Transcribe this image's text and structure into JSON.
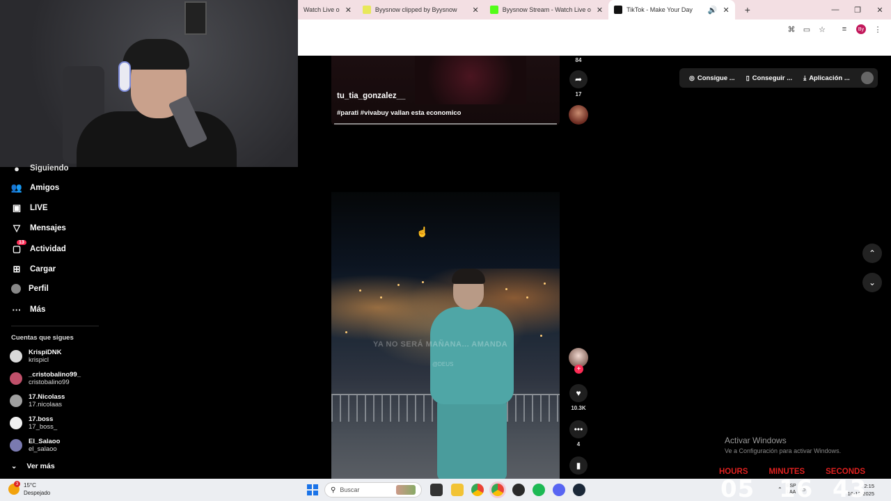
{
  "browser": {
    "tabs": [
      {
        "label": "Watch Live o",
        "color": "#9146ff"
      },
      {
        "label": "Byysnow clipped by Byysnow",
        "color": "#e8e85a"
      },
      {
        "label": "Byysnow Stream - Watch Live o",
        "color": "#53fc18"
      },
      {
        "label": "TikTok - Make Your Day",
        "color": "#111111"
      }
    ],
    "profile_initials": "By"
  },
  "sidebar": {
    "partial_item": "Siguiendo",
    "items": [
      {
        "label": "Amigos",
        "icon": "friends-icon"
      },
      {
        "label": "LIVE",
        "icon": "live-icon"
      },
      {
        "label": "Mensajes",
        "icon": "messages-icon"
      },
      {
        "label": "Actividad",
        "icon": "activity-icon",
        "badge": "13"
      },
      {
        "label": "Cargar",
        "icon": "upload-icon"
      },
      {
        "label": "Perfil",
        "icon": "profile-icon"
      },
      {
        "label": "Más",
        "icon": "more-icon"
      }
    ],
    "following_title": "Cuentas que sigues",
    "accounts": [
      {
        "name": "KrispiDNK",
        "handle": "krispicl",
        "color": "#d9d9d9"
      },
      {
        "name": "_cristobalino99_",
        "handle": "cristobalino99",
        "color": "#c0506a"
      },
      {
        "name": "17.Nicolass",
        "handle": "17.nicolaas",
        "color": "#a0a0a0"
      },
      {
        "name": "17.boss",
        "handle": "17_boss_",
        "color": "#f0f0f0"
      },
      {
        "name": "El_Salaoo",
        "handle": "el_salaoo",
        "color": "#7a7ab0"
      }
    ],
    "see_more": "Ver más"
  },
  "feed": {
    "prev_video": {
      "username": "tu_tia_gonzalez__",
      "description": "#parati #vivabuy vallan esta economico",
      "top_count": "84",
      "share_count": "17"
    },
    "current_video": {
      "overlay_text": "YA NO SERÁ MAÑANA... AMANDA",
      "watermark": "@DEUS",
      "likes": "10.3K",
      "comments": "4"
    }
  },
  "top_pills": [
    {
      "label": "Consigue ...",
      "icon": "coin-icon"
    },
    {
      "label": "Conseguir ...",
      "icon": "phone-icon"
    },
    {
      "label": "Aplicación ...",
      "icon": "download-icon"
    }
  ],
  "windows": {
    "activate_title": "Activar Windows",
    "activate_sub": "Ve a Configuración para activar Windows."
  },
  "timer": {
    "labels": [
      "HOURS",
      "MINUTES",
      "SECONDS"
    ],
    "hours": "05",
    "minutes": "16",
    "seconds": "43"
  },
  "taskbar": {
    "weather_temp": "15°C",
    "weather_desc": "Despejado",
    "weather_badge": "3",
    "search_placeholder": "Buscar",
    "lang_top": "ESP",
    "lang_bottom": "LAA",
    "time": "2:15",
    "date": "16-12-2025"
  }
}
